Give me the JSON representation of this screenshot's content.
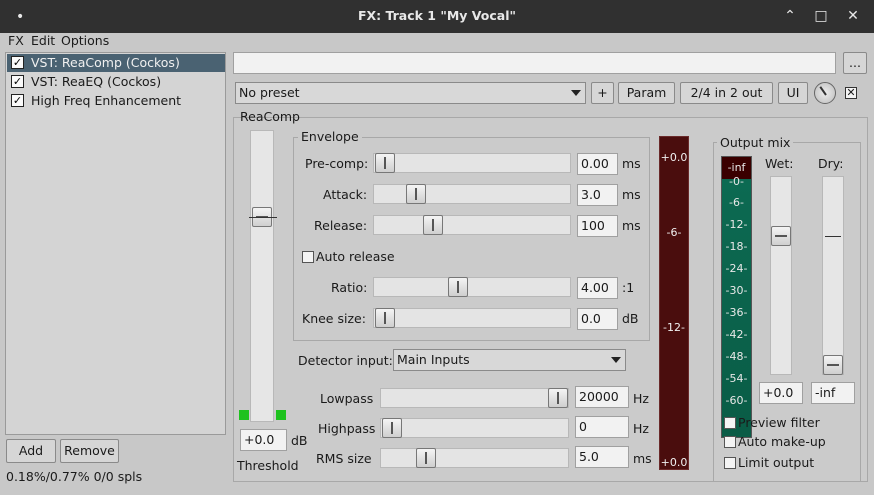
{
  "window": {
    "title": "FX: Track 1 \"My Vocal\""
  },
  "menu": {
    "fx": "FX",
    "edit": "Edit",
    "options": "Options"
  },
  "fx_chain": [
    {
      "label": "VST: ReaComp (Cockos)",
      "checked": true,
      "selected": true
    },
    {
      "label": "VST: ReaEQ (Cockos)",
      "checked": true,
      "selected": false
    },
    {
      "label": "High Freq Enhancement",
      "checked": true,
      "selected": false
    }
  ],
  "buttons": {
    "add": "Add",
    "remove": "Remove",
    "browse": "...",
    "plus": "+",
    "param": "Param",
    "routing": "2/4 in 2 out",
    "ui": "UI"
  },
  "status": "0.18%/0.77% 0/0 spls",
  "preset": {
    "value": "No preset"
  },
  "plugin": {
    "name": "ReaComp"
  },
  "threshold": {
    "label": "Threshold",
    "value": "+0.0",
    "unit": "dB",
    "level": 0.73
  },
  "envelope": {
    "title": "Envelope",
    "precomp": {
      "label": "Pre-comp:",
      "value": "0.00",
      "unit": "ms",
      "pos": 0.0
    },
    "attack": {
      "label": "Attack:",
      "value": "3.0",
      "unit": "ms",
      "pos": 0.2
    },
    "release": {
      "label": "Release:",
      "value": "100",
      "unit": "ms",
      "pos": 0.3
    },
    "auto_release": {
      "label": "Auto release",
      "checked": false
    },
    "ratio": {
      "label": "Ratio:",
      "value": "4.00",
      "unit": ":1",
      "pos": 0.43
    },
    "knee": {
      "label": "Knee size:",
      "value": "0.0",
      "unit": "dB",
      "pos": 0.0
    }
  },
  "detector": {
    "label": "Detector input:",
    "value": "Main Inputs"
  },
  "lowpass": {
    "label": "Lowpass",
    "value": "20000",
    "unit": "Hz",
    "pos": 0.99
  },
  "highpass": {
    "label": "Highpass",
    "value": "0",
    "unit": "Hz",
    "pos": 0.0
  },
  "rms": {
    "label": "RMS size",
    "value": "5.0",
    "unit": "ms",
    "pos": 0.18
  },
  "gr_meter": {
    "top": "+0.0",
    "mid": "-6-",
    "low": "-12-",
    "bottom": "+0.0"
  },
  "output_mix": {
    "title": "Output mix",
    "wet_label": "Wet:",
    "dry_label": "Dry:",
    "wet_value": "+0.0",
    "dry_value": "-inf",
    "wet_level": 0.72,
    "dry_level": 0.0,
    "meter_labels": [
      "-inf",
      "-0-",
      "-6-",
      "-12-",
      "-18-",
      "-24-",
      "-30-",
      "-36-",
      "-42-",
      "-48-",
      "-54-",
      "-60-"
    ]
  },
  "options": {
    "preview_filter": {
      "label": "Preview filter",
      "checked": false
    },
    "auto_makeup": {
      "label": "Auto make-up",
      "checked": false
    },
    "limit_output": {
      "label": "Limit output",
      "checked": false
    }
  }
}
